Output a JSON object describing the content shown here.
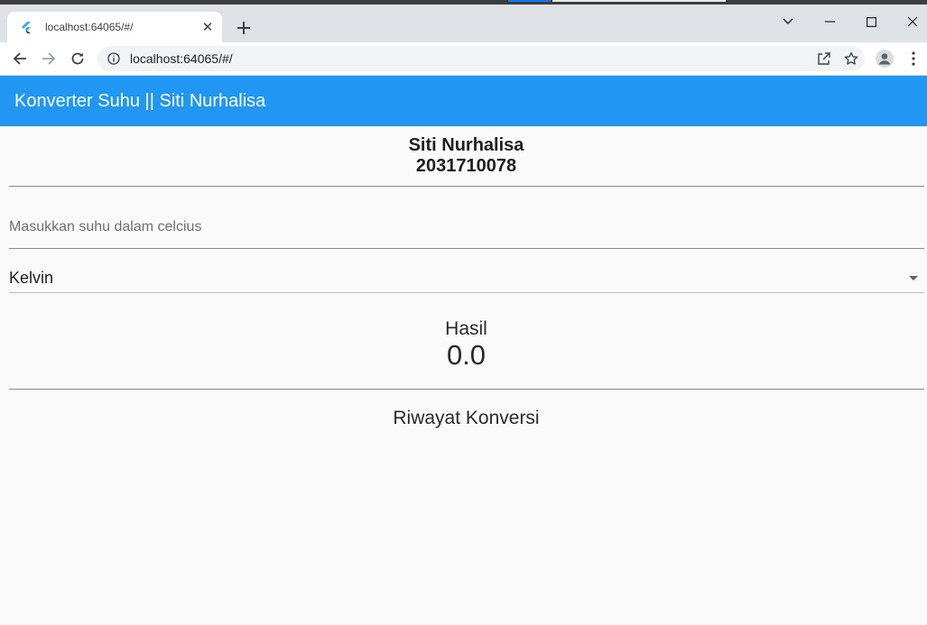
{
  "browser": {
    "tab": {
      "title": "localhost:64065/#/",
      "favicon": "flutter-icon"
    },
    "url": "localhost:64065/#/",
    "icons": {
      "back": "back-arrow-icon",
      "forward": "forward-arrow-icon",
      "reload": "reload-icon",
      "site_info": "info-icon",
      "share": "share-icon",
      "bookmark": "star-icon",
      "profile": "profile-icon",
      "menu": "kebab-menu-icon"
    }
  },
  "app": {
    "title": "Konverter Suhu || Siti Nurhalisa",
    "accent_color": "#2196f3"
  },
  "header": {
    "name": "Siti Nurhalisa",
    "nim": "2031710078"
  },
  "input": {
    "placeholder": "Masukkan suhu dalam celcius",
    "value": ""
  },
  "dropdown": {
    "selected": "Kelvin"
  },
  "result": {
    "label": "Hasil",
    "value": "0.0"
  },
  "history": {
    "title": "Riwayat Konversi",
    "items": []
  }
}
